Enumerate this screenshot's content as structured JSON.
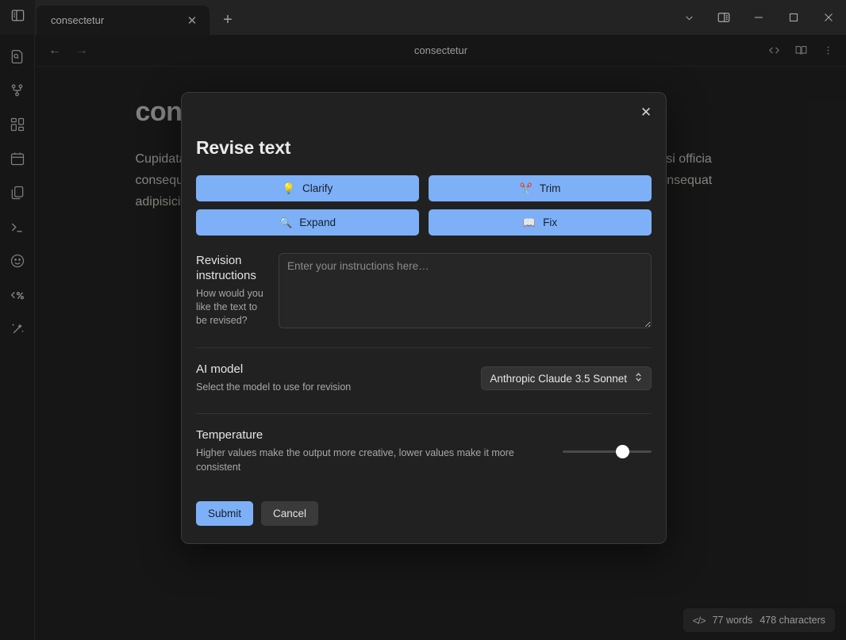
{
  "window": {
    "sidebar_toggle_icon": "panel-left-icon",
    "tabs": [
      {
        "title": "consectetur",
        "close_icon": "close-icon",
        "active": true
      }
    ],
    "new_tab_icon": "plus-icon",
    "controls": {
      "chevron_icon": "chevron-down-icon",
      "split_icon": "split-view-icon",
      "minimize": "—",
      "maximize": "□",
      "close": "✕"
    }
  },
  "activitybar": {
    "items": [
      {
        "icon": "file-search-icon",
        "label": "Search files"
      },
      {
        "icon": "git-branch-icon",
        "label": "Version control"
      },
      {
        "icon": "blocks-icon",
        "label": "Blocks"
      },
      {
        "icon": "calendar-icon",
        "label": "Calendar"
      },
      {
        "icon": "copy-files-icon",
        "label": "Files"
      },
      {
        "icon": "terminal-icon",
        "label": "Terminal"
      },
      {
        "icon": "smiley-icon",
        "label": "Emoji"
      },
      {
        "icon": "code-percent-icon",
        "label": "Snippets"
      },
      {
        "icon": "magic-wand-icon",
        "label": "AI tools"
      }
    ]
  },
  "doc_toolbar": {
    "back_icon": "arrow-left-icon",
    "forward_icon": "arrow-right-icon",
    "title": "consectetur",
    "actions": [
      {
        "icon": "source-code-icon",
        "label": "Source code"
      },
      {
        "icon": "book-icon",
        "label": "Reading view"
      },
      {
        "icon": "more-vertical-icon",
        "label": "More options"
      }
    ]
  },
  "document": {
    "heading": "consectetur",
    "paragraph": "Cupidatat occaecat quis voluptate et laboris minim aliqua minim. Sunt veniam excepteur nisi nisi officia consequat excepteur aliquip sint aute nostrud ea occaecat duis culpa dolor incididunt minim consequat adipisicing dolor nisi. Culpa eu aute dolore qui laborum nostrud minim commodo",
    "wordcount": {
      "code_icon": "code-brackets-icon",
      "words": "77 words",
      "characters": "478 characters"
    }
  },
  "modal": {
    "title": "Revise text",
    "close_icon": "close-icon",
    "quick_actions": [
      {
        "emoji": "💡",
        "icon": "lightbulb-icon",
        "label": "Clarify"
      },
      {
        "emoji": "✂️",
        "icon": "scissors-icon",
        "label": "Trim"
      },
      {
        "emoji": "🔍",
        "icon": "magnifier-icon",
        "label": "Expand"
      },
      {
        "emoji": "📖",
        "icon": "open-book-icon",
        "label": "Fix"
      }
    ],
    "instructions": {
      "label": "Revision instructions",
      "help": "How would you like the text to be revised?",
      "placeholder": "Enter your instructions here…",
      "value": ""
    },
    "model": {
      "title": "AI model",
      "description": "Select the model to use for revision",
      "selected": "Anthropic Claude 3.5 Sonnet",
      "chevron_icon": "chevron-up-down-icon"
    },
    "temperature": {
      "title": "Temperature",
      "description": "Higher values make the output more creative, lower values make it more consistent",
      "value_percent": 67
    },
    "submit_label": "Submit",
    "cancel_label": "Cancel"
  },
  "colors": {
    "accent_blue": "#7db0f7",
    "window_bg": "#1b1b1b",
    "modal_bg": "#212121",
    "tab_active": "#1e1e1e"
  }
}
